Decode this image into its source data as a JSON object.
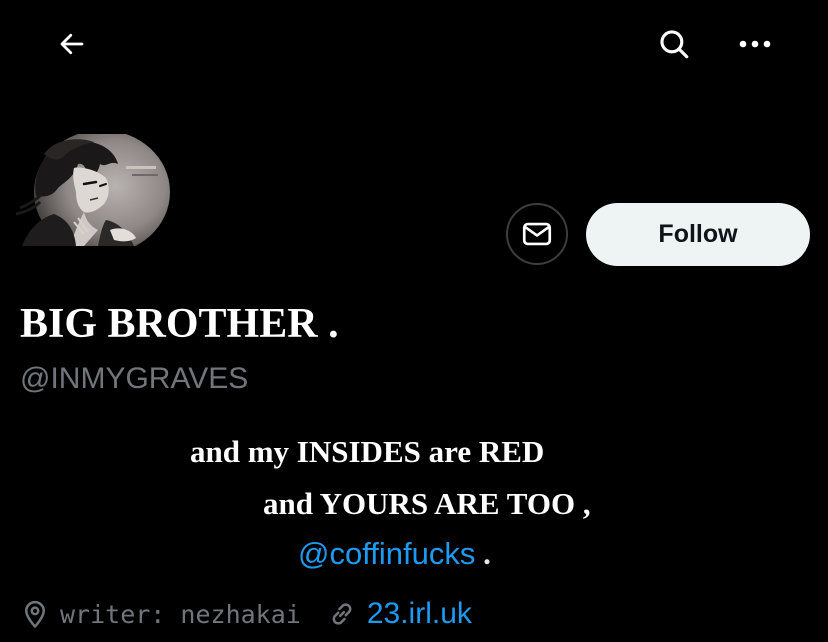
{
  "header": {
    "back_icon": "arrow-left-icon",
    "search_icon": "search-icon",
    "more_icon": "more-horizontal-icon"
  },
  "profile": {
    "avatar_icon": "avatar-illustration",
    "display_name": "BIG BROTHER .",
    "handle": "@INMYGRAVES",
    "message_icon": "envelope-icon",
    "follow_label": "Follow"
  },
  "bio": {
    "line1": "and my INSIDES are RED",
    "line2": "and YOURS ARE TOO ,",
    "mention": "@coffinfucks",
    "line3_suffix": " ."
  },
  "meta": {
    "location_icon": "location-pin-icon",
    "location": "writer: nezhakai",
    "link_icon": "link-icon",
    "link": "23.irl.uk"
  },
  "colors": {
    "background": "#000000",
    "accent": "#1d9bf0",
    "secondary_text": "#71767b",
    "follow_bg": "#eef3f4"
  }
}
